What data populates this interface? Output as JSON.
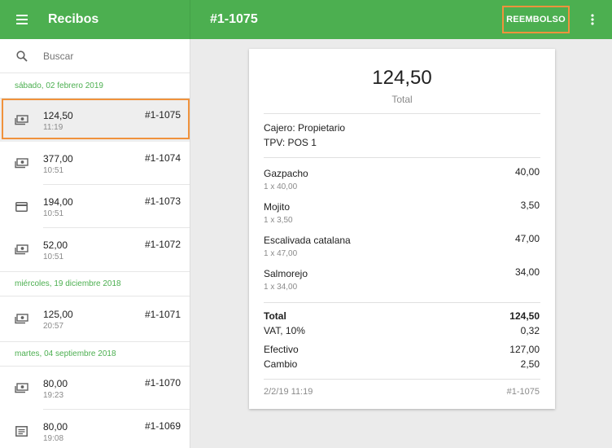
{
  "topbar": {
    "app_title": "Recibos",
    "receipt_title": "#1-1075",
    "refund_label": "REEMBOLSO",
    "accent_color": "#4caf50",
    "highlight_color": "#f0923c"
  },
  "sidebar": {
    "search_placeholder": "Buscar",
    "groups": [
      {
        "date": "sábado, 02 febrero 2019",
        "items": [
          {
            "icon": "cash-icon",
            "amount": "124,50",
            "time": "11:19",
            "number": "#1-1075",
            "selected": true
          },
          {
            "icon": "cash-icon",
            "amount": "377,00",
            "time": "10:51",
            "number": "#1-1074"
          },
          {
            "icon": "card-icon",
            "amount": "194,00",
            "time": "10:51",
            "number": "#1-1073"
          },
          {
            "icon": "cash-icon",
            "amount": "52,00",
            "time": "10:51",
            "number": "#1-1072"
          }
        ]
      },
      {
        "date": "miércoles, 19 diciembre 2018",
        "items": [
          {
            "icon": "cash-icon",
            "amount": "125,00",
            "time": "20:57",
            "number": "#1-1071"
          }
        ]
      },
      {
        "date": "martes, 04 septiembre 2018",
        "items": [
          {
            "icon": "cash-icon",
            "amount": "80,00",
            "time": "19:23",
            "number": "#1-1070"
          },
          {
            "icon": "receipt-icon",
            "amount": "80,00",
            "time": "19:08",
            "number": "#1-1069"
          }
        ]
      }
    ]
  },
  "receipt": {
    "total": "124,50",
    "total_label": "Total",
    "cashier": "Cajero: Propietario",
    "pos": "TPV: POS 1",
    "lines": [
      {
        "name": "Gazpacho",
        "qty": "1 x 40,00",
        "amount": "40,00"
      },
      {
        "name": "Mojito",
        "qty": "1 x 3,50",
        "amount": "3,50"
      },
      {
        "name": "Escalivada catalana",
        "qty": "1 x 47,00",
        "amount": "47,00"
      },
      {
        "name": "Salmorejo",
        "qty": "1 x 34,00",
        "amount": "34,00"
      }
    ],
    "summary": {
      "total_label": "Total",
      "total_value": "124,50",
      "vat_label": "VAT,  10%",
      "vat_value": "0,32",
      "cash_label": "Efectivo",
      "cash_value": "127,00",
      "change_label": "Cambio",
      "change_value": "2,50"
    },
    "footer_date": "2/2/19 11:19",
    "footer_number": "#1-1075"
  }
}
